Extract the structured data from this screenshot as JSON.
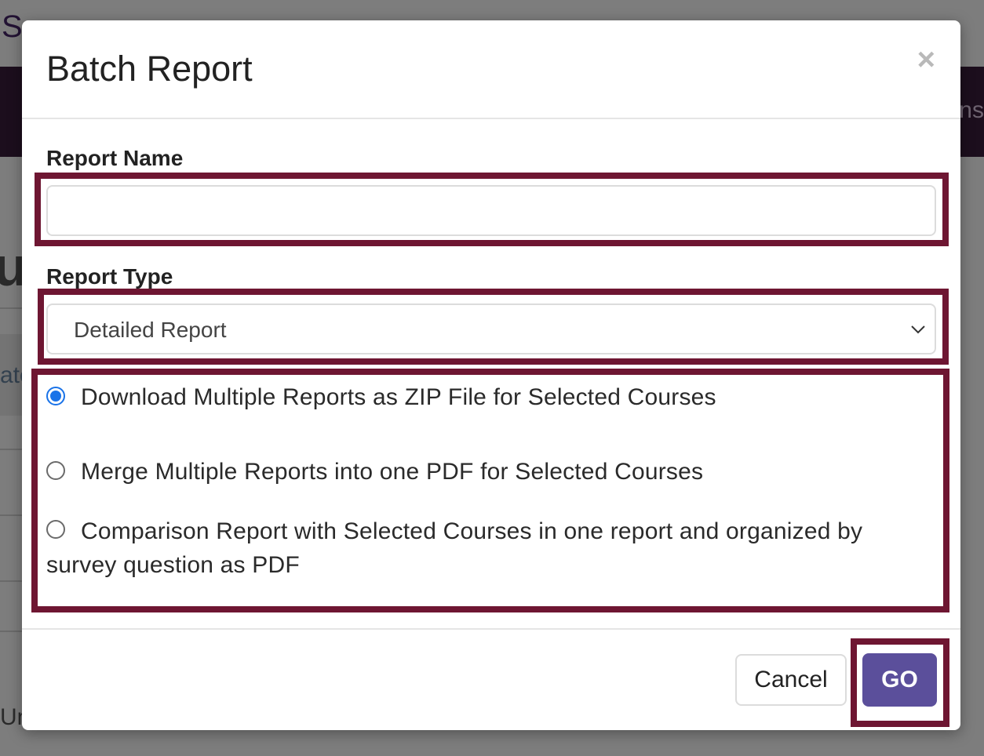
{
  "background": {
    "fragments": [
      "S",
      "Ins",
      "ul",
      "ate",
      "Un"
    ]
  },
  "modal": {
    "title": "Batch Report",
    "close_symbol": "×",
    "report_name": {
      "label": "Report Name",
      "value": "",
      "placeholder": ""
    },
    "report_type": {
      "label": "Report Type",
      "selected": "Detailed Report"
    },
    "options": [
      {
        "label": "Download Multiple Reports as ZIP File for Selected Courses",
        "checked": true
      },
      {
        "label": "Merge Multiple Reports into one PDF for Selected Courses",
        "checked": false
      },
      {
        "label": "Comparison Report with Selected Courses in one report and organized by survey question as PDF",
        "checked": false
      }
    ],
    "buttons": {
      "cancel": "Cancel",
      "go": "GO"
    }
  },
  "colors": {
    "highlight": "#6e1632",
    "go_button": "#5b4f9b",
    "radio_selected": "#1a73e8"
  }
}
